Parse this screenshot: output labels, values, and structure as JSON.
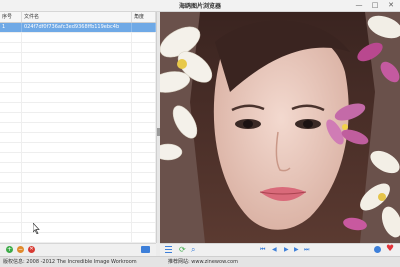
{
  "window": {
    "title": "海鸥图片浏览器",
    "minimize": "—",
    "maximize": "□",
    "close": "✕"
  },
  "file_table": {
    "headers": [
      "序号",
      "文件名",
      "角度"
    ],
    "rows": [
      {
        "index": "1",
        "filename": "024f7df0f736afc3ed9368ffb119ebc4b",
        "angle": ""
      }
    ]
  },
  "status": {
    "copyright": "版权信息: 2008 -2012 The Incredible Image Workroom",
    "website": "推荐网站: www.zinewow.com"
  },
  "colors": {
    "selection": "#6fa9e6",
    "accent_blue": "#3d7fd9",
    "heart": "#e2333a"
  }
}
